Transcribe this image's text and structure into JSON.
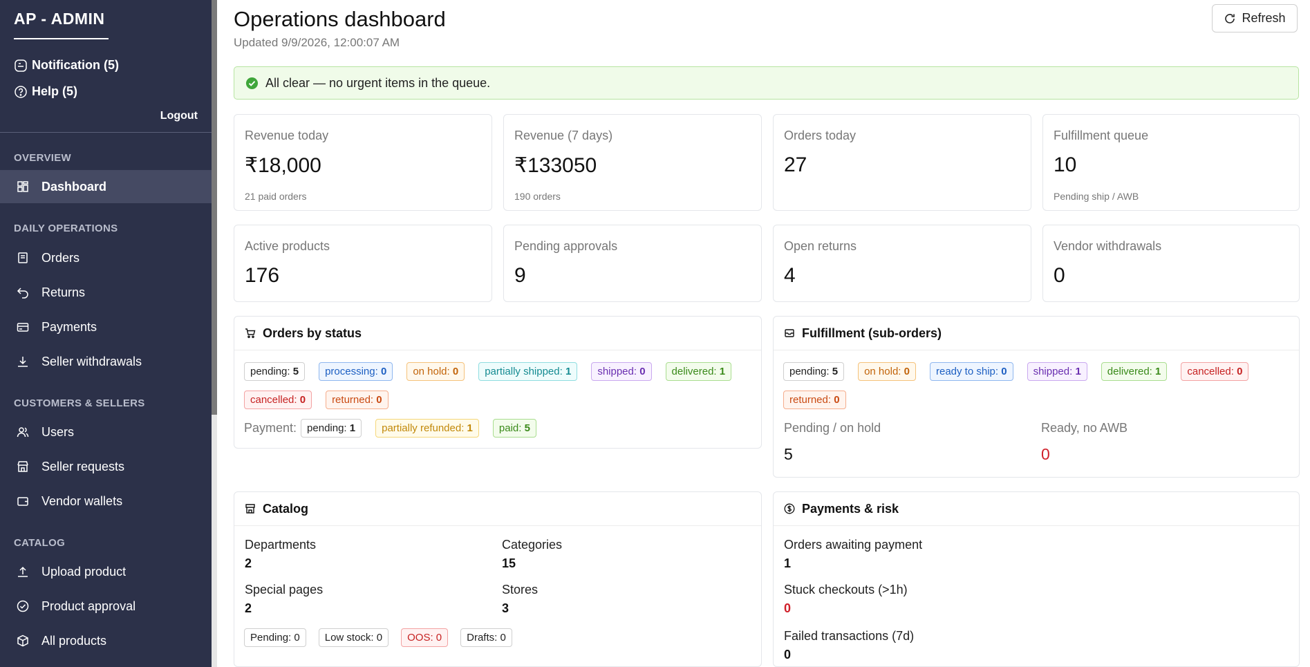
{
  "sidebar": {
    "brand": "AP - ADMIN",
    "notification": "Notification (5)",
    "help": "Help (5)",
    "logout": "Logout",
    "sections": [
      {
        "title": "OVERVIEW",
        "items": [
          {
            "label": "Dashboard",
            "icon": "dashboard-icon",
            "active": true
          }
        ]
      },
      {
        "title": "DAILY OPERATIONS",
        "items": [
          {
            "label": "Orders",
            "icon": "orders-icon"
          },
          {
            "label": "Returns",
            "icon": "returns-icon"
          },
          {
            "label": "Payments",
            "icon": "payments-icon"
          },
          {
            "label": "Seller withdrawals",
            "icon": "download-icon"
          }
        ]
      },
      {
        "title": "CUSTOMERS & SELLERS",
        "items": [
          {
            "label": "Users",
            "icon": "users-icon"
          },
          {
            "label": "Seller requests",
            "icon": "shop-icon"
          },
          {
            "label": "Vendor wallets",
            "icon": "wallet-icon"
          }
        ]
      },
      {
        "title": "CATALOG",
        "items": [
          {
            "label": "Upload product",
            "icon": "upload-icon"
          },
          {
            "label": "Product approval",
            "icon": "check-circle-icon"
          },
          {
            "label": "All products",
            "icon": "box-icon"
          }
        ]
      }
    ]
  },
  "header": {
    "title": "Operations dashboard",
    "updated": "Updated 9/9/2026, 12:00:07 AM",
    "refresh": "Refresh"
  },
  "alert": {
    "text": "All clear — no urgent items in the queue."
  },
  "stats": [
    {
      "label": "Revenue today",
      "value": "₹18,000",
      "sub": "21 paid orders"
    },
    {
      "label": "Revenue (7 days)",
      "value": "₹133050",
      "sub": "190 orders"
    },
    {
      "label": "Orders today",
      "value": "27",
      "sub": ""
    },
    {
      "label": "Fulfillment queue",
      "value": "10",
      "sub": "Pending ship / AWB"
    },
    {
      "label": "Active products",
      "value": "176",
      "sub": ""
    },
    {
      "label": "Pending approvals",
      "value": "9",
      "sub": ""
    },
    {
      "label": "Open returns",
      "value": "4",
      "sub": ""
    },
    {
      "label": "Vendor withdrawals",
      "value": "0",
      "sub": ""
    }
  ],
  "orders_by_status": {
    "title": "Orders by status",
    "tags": [
      {
        "label": "pending:",
        "count": "5",
        "color": "default"
      },
      {
        "label": "processing:",
        "count": "0",
        "color": "blue"
      },
      {
        "label": "on hold:",
        "count": "0",
        "color": "orange"
      },
      {
        "label": "partially shipped:",
        "count": "1",
        "color": "cyan"
      },
      {
        "label": "shipped:",
        "count": "0",
        "color": "purple"
      },
      {
        "label": "delivered:",
        "count": "1",
        "color": "green"
      },
      {
        "label": "cancelled:",
        "count": "0",
        "color": "red"
      },
      {
        "label": "returned:",
        "count": "0",
        "color": "volcano"
      }
    ],
    "payment_label": "Payment:",
    "payment_tags": [
      {
        "label": "pending:",
        "count": "1",
        "color": "default"
      },
      {
        "label": "partially refunded:",
        "count": "1",
        "color": "gold"
      },
      {
        "label": "paid:",
        "count": "5",
        "color": "green"
      }
    ]
  },
  "fulfillment": {
    "title": "Fulfillment (sub-orders)",
    "tags": [
      {
        "label": "pending:",
        "count": "5",
        "color": "default"
      },
      {
        "label": "on hold:",
        "count": "0",
        "color": "orange"
      },
      {
        "label": "ready to ship:",
        "count": "0",
        "color": "blue"
      },
      {
        "label": "shipped:",
        "count": "1",
        "color": "purple"
      },
      {
        "label": "delivered:",
        "count": "1",
        "color": "green"
      },
      {
        "label": "cancelled:",
        "count": "0",
        "color": "red"
      },
      {
        "label": "returned:",
        "count": "0",
        "color": "volcano"
      }
    ],
    "pending_label": "Pending / on hold",
    "pending_value": "5",
    "ready_label": "Ready, no AWB",
    "ready_value": "0"
  },
  "catalog": {
    "title": "Catalog",
    "departments_label": "Departments",
    "departments_value": "2",
    "categories_label": "Categories",
    "categories_value": "15",
    "special_label": "Special pages",
    "special_value": "2",
    "stores_label": "Stores",
    "stores_value": "3",
    "tags": [
      {
        "text": "Pending: 0",
        "color": "default"
      },
      {
        "text": "Low stock: 0",
        "color": "default"
      },
      {
        "text": "OOS: 0",
        "color": "red"
      },
      {
        "text": "Drafts: 0",
        "color": "default"
      }
    ]
  },
  "payments_risk": {
    "title": "Payments & risk",
    "awaiting_label": "Orders awaiting payment",
    "awaiting_value": "1",
    "stuck_label": "Stuck checkouts (>1h)",
    "stuck_value": "0",
    "failed_label": "Failed transactions (7d)",
    "failed_value": "0"
  }
}
